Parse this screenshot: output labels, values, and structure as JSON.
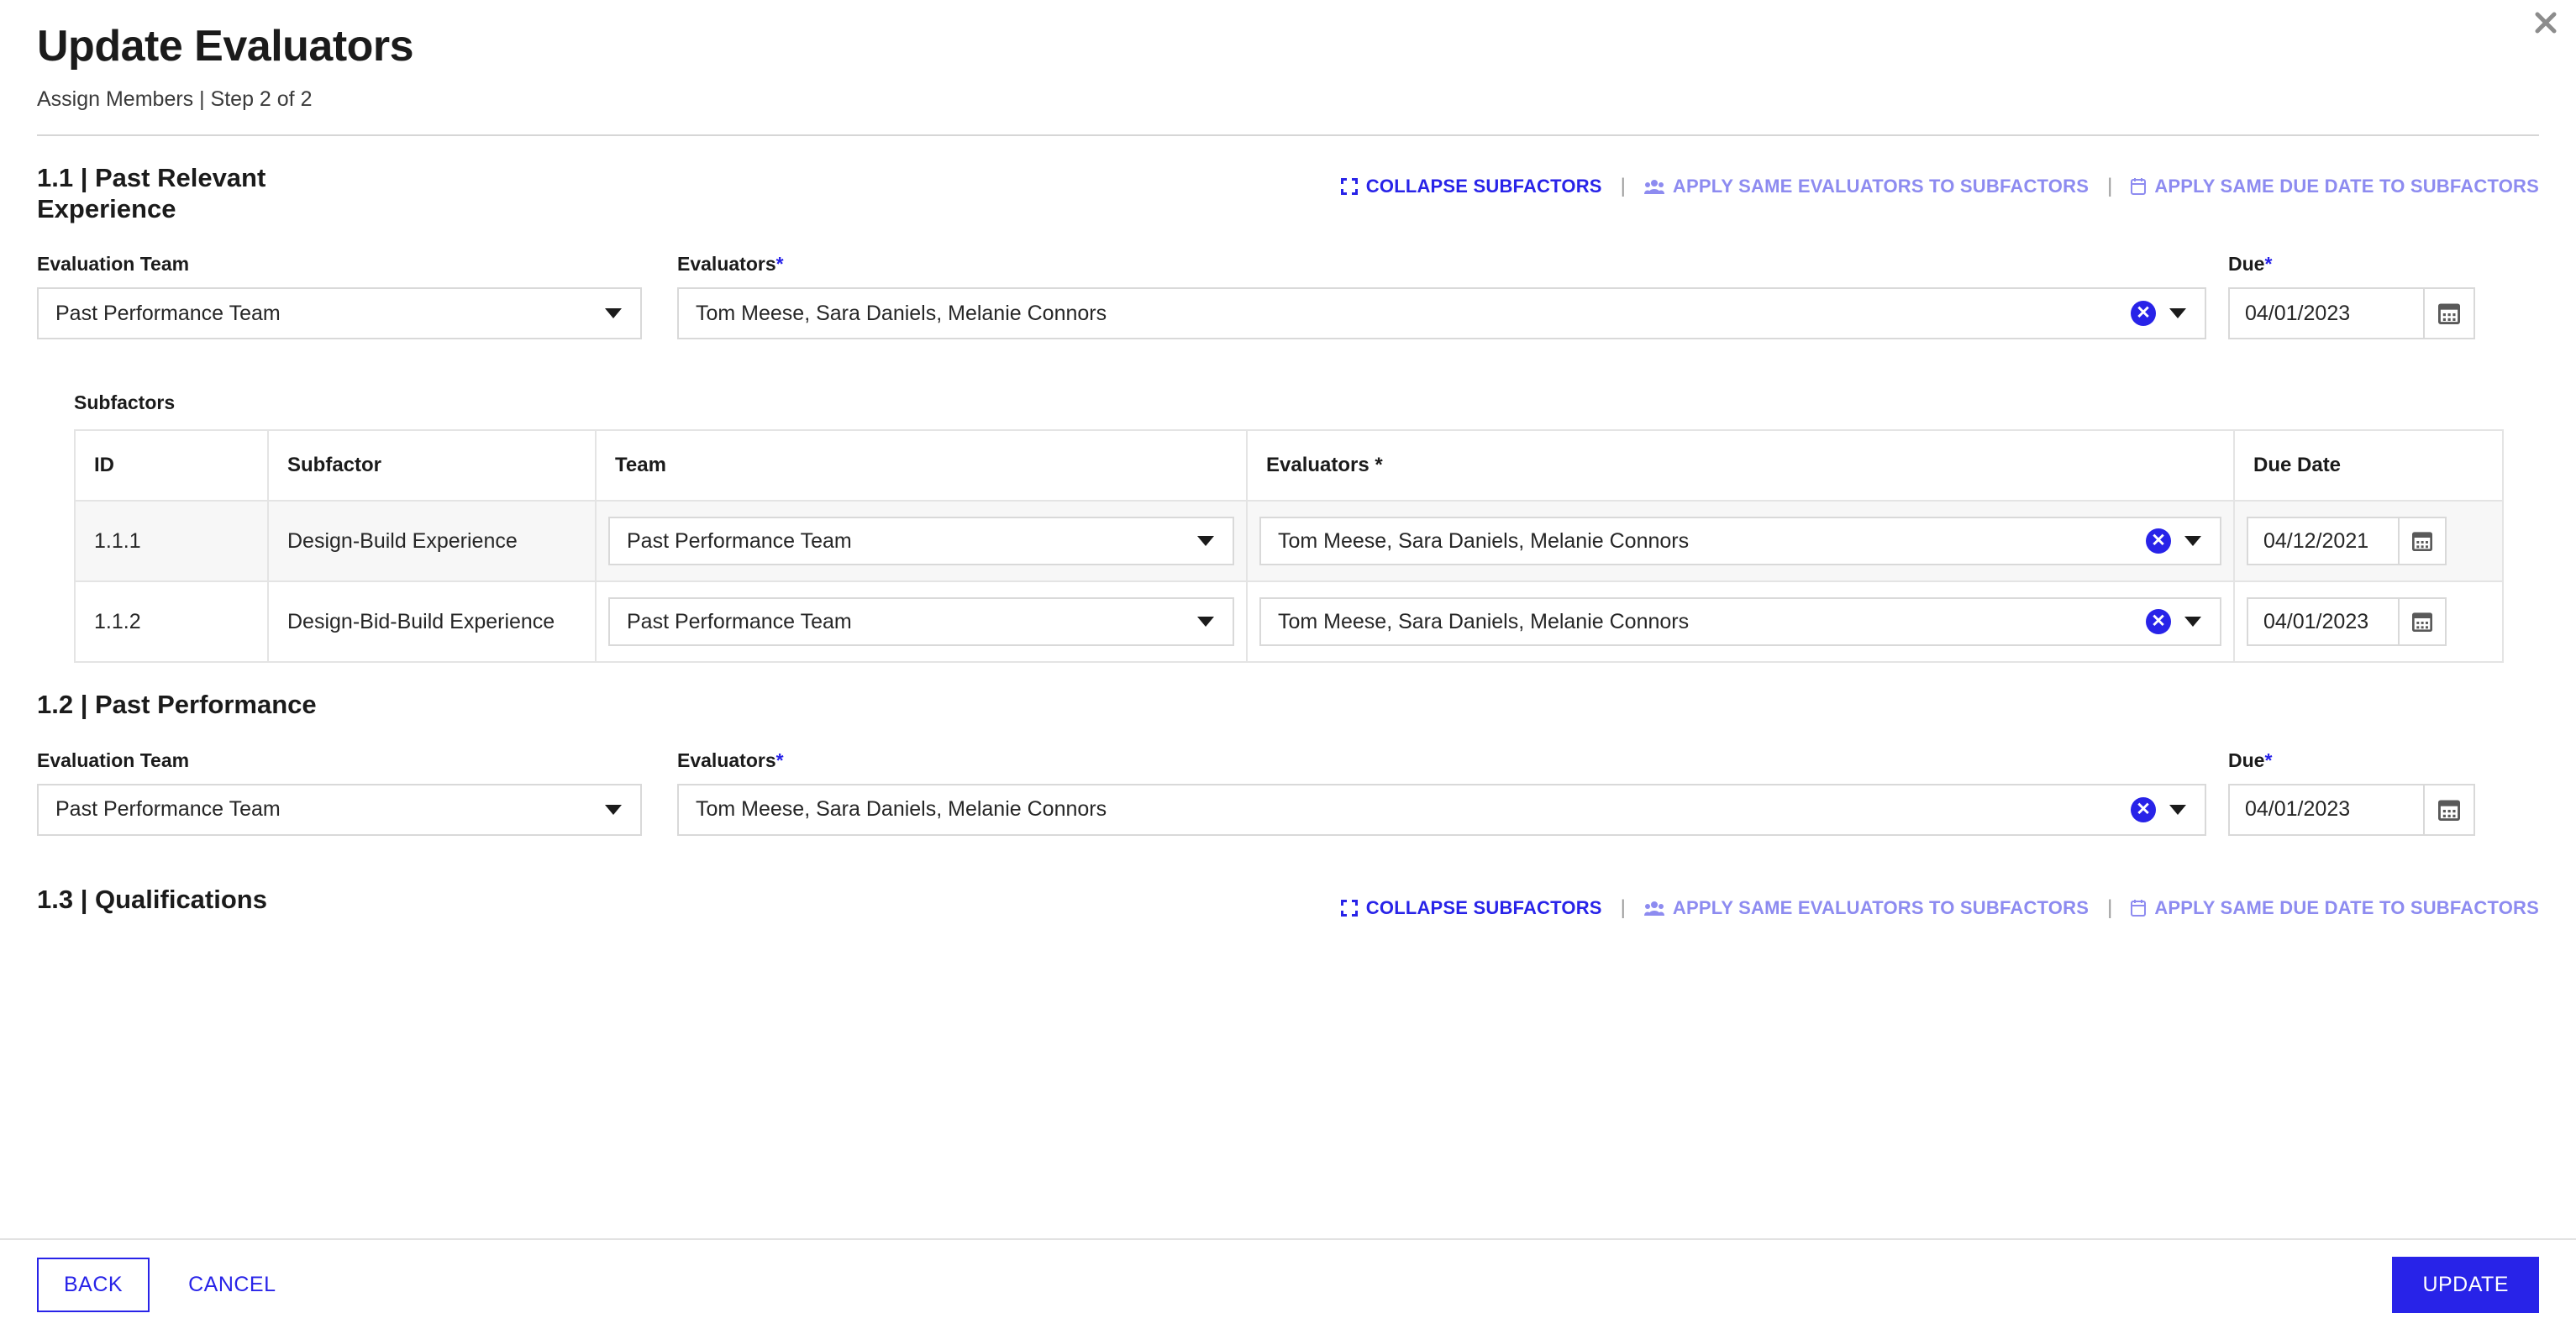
{
  "header": {
    "title": "Update Evaluators",
    "subtitle": "Assign Members | Step 2 of 2",
    "close_icon": "close-icon"
  },
  "colors": {
    "accent": "#2823e8",
    "accent_disabled": "#8d8bf0",
    "border": "#d9d9d9",
    "row_alt": "#f7f7f7",
    "close": "#8c8c8c"
  },
  "action_links": {
    "collapse": "COLLAPSE SUBFACTORS",
    "apply_evaluators": "APPLY SAME EVALUATORS TO SUBFACTORS",
    "apply_due_date": "APPLY SAME DUE DATE TO SUBFACTORS",
    "separator": "|",
    "icons": {
      "collapse": "collapse-subfactors-icon",
      "apply_evaluators": "people-group-icon",
      "apply_due_date": "calendar-icon"
    }
  },
  "labels": {
    "evaluation_team": "Evaluation Team",
    "evaluators": "Evaluators",
    "due": "Due",
    "required_mark": "*",
    "subfactors": "Subfactors"
  },
  "table_headers": {
    "id": "ID",
    "subfactor": "Subfactor",
    "team": "Team",
    "evaluators": "Evaluators *",
    "due_date": "Due Date"
  },
  "sections": [
    {
      "title": "1.1 | Past Relevant Experience",
      "has_actions": true,
      "team": "Past Performance Team",
      "evaluators": "Tom Meese, Sara Daniels, Melanie Connors",
      "due": "04/01/2023",
      "subfactors": [
        {
          "id": "1.1.1",
          "name": "Design-Build Experience",
          "team": "Past Performance Team",
          "evaluators": "Tom Meese, Sara Daniels, Melanie Connors",
          "due": "04/12/2021"
        },
        {
          "id": "1.1.2",
          "name": "Design-Bid-Build Experience",
          "team": "Past Performance Team",
          "evaluators": "Tom Meese, Sara Daniels, Melanie Connors",
          "due": "04/01/2023"
        }
      ]
    },
    {
      "title": "1.2 | Past Performance",
      "has_actions": false,
      "team": "Past Performance Team",
      "evaluators": "Tom Meese, Sara Daniels, Melanie Connors",
      "due": "04/01/2023",
      "subfactors": []
    },
    {
      "title": "1.3 | Qualifications",
      "has_actions": true,
      "team": "",
      "evaluators": "",
      "due": "",
      "subfactors": []
    }
  ],
  "footer": {
    "back": "BACK",
    "cancel": "CANCEL",
    "update": "UPDATE"
  }
}
